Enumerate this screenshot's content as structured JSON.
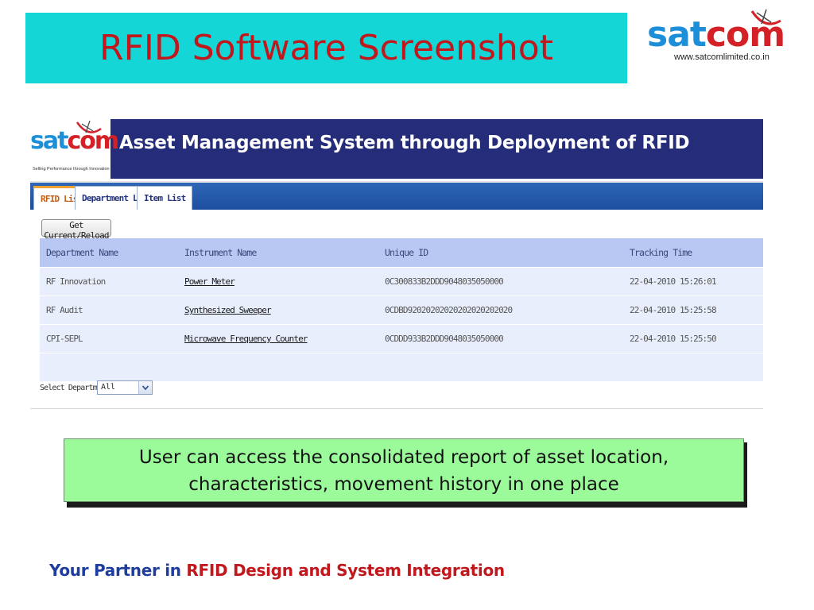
{
  "slide": {
    "title": "RFID Software Screenshot",
    "logo": {
      "word_part1": "sat",
      "word_part2": "com",
      "url": "www.satcomlimited.co.in"
    },
    "callout_text": "User can access the consolidated report of asset location, characteristics, movement history in one place",
    "footer_part1": "Your Partner in ",
    "footer_part2": "RFID Design and System Integration"
  },
  "app": {
    "logo_word_part1": "sat",
    "logo_word_part2": "com",
    "logo_tagline": "Selling Performance through Innovation",
    "title": "Asset Management System through Deployment of RFID",
    "tabs": [
      {
        "label": "RFID List",
        "active": true
      },
      {
        "label": "Department List",
        "active": false
      },
      {
        "label": "Item List",
        "active": false
      }
    ],
    "reload_button": "Get Current/Reload",
    "table": {
      "columns": [
        "Department Name",
        "Instrument Name",
        "Unique ID",
        "Tracking Time"
      ],
      "rows": [
        [
          "RF Innovation",
          "Power Meter",
          "0C300833B2DDD9048035050000",
          "22-04-2010 15:26:01"
        ],
        [
          "RF Audit",
          "Synthesized Sweeper",
          "0CDBD92020202020202020202020",
          "22-04-2010 15:25:58"
        ],
        [
          "CPI-SEPL",
          "Microwave Frequency Counter",
          "0CDDD933B2DDD9048035050000",
          "22-04-2010 15:25:50"
        ]
      ]
    },
    "department_filter": {
      "label": "Select Department:",
      "value": "All"
    }
  },
  "colors": {
    "title_bg": "#14d6d6",
    "title_text": "#c0181c",
    "app_header": "#252d7a",
    "nav_bar": "#1c4f9e",
    "table_header": "#b9c8f2",
    "table_row": "#e8eefc",
    "callout_bg": "#9bfb9b",
    "footer_blue": "#1f3d9e",
    "footer_red": "#c0181c"
  },
  "icons": [
    "satellite-dish-icon",
    "dropdown-arrow-icon"
  ]
}
